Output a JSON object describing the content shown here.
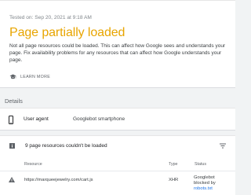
{
  "summary": {
    "tested_on": "Tested on: Sep 20, 2021 at 9:18 AM",
    "headline": "Page partially loaded",
    "description": "Not all page resources could be loaded. This can affect how Google sees and understands your page. Fix availability problems for any resources that can affect how Google understands your page.",
    "learn_more": "LEARN MORE",
    "headline_color": "#e8a500"
  },
  "details": {
    "label": "Details",
    "user_agent_label": "User agent",
    "user_agent_value": "Googlebot smartphone"
  },
  "resources": {
    "summary": "9 page resources couldn't be loaded",
    "columns": [
      "Resource",
      "Type",
      "Status"
    ],
    "rows": [
      {
        "resource": "https://marqueejewelry.com/cart.js",
        "type": "XHR",
        "status_line1": "Googlebot",
        "status_line2": "blocked by",
        "status_link": "robots.txt"
      }
    ]
  },
  "icons": {
    "learn_more": "school-icon",
    "user_agent": "smartphone-icon",
    "resources_info": "info-icon",
    "filter": "filter-icon",
    "row_status": "warning-icon"
  }
}
